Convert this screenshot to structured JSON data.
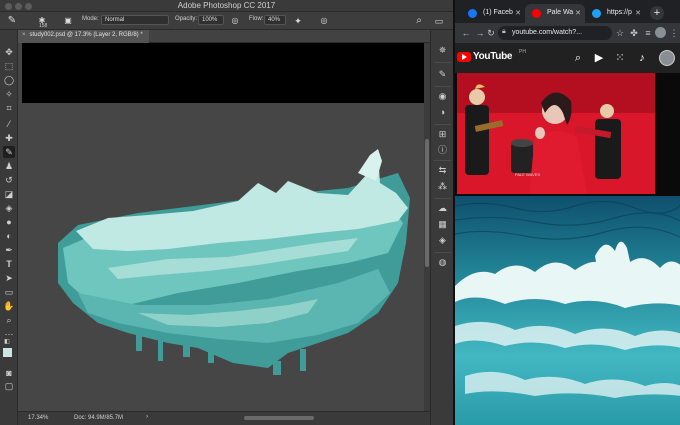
{
  "photoshop": {
    "window_title": "Adobe Photoshop CC 2017",
    "options": {
      "brush_size": "158",
      "mode_label": "Mode:",
      "mode_value": "Normal",
      "opacity_label": "Opacity:",
      "opacity_value": "100%",
      "flow_label": "Flow:",
      "flow_value": "40%"
    },
    "document_tab": "study002.psd @ 17.3% (Layer 2, RGB/8) *",
    "status": {
      "zoom": "17.34%",
      "doc_size": "Doc: 94.9M/85.7M"
    },
    "colors": {
      "foreground": "#c9e6e4",
      "background": "#ffffff",
      "wave_light": "#bfe9e2",
      "wave_mid": "#6fc6bf",
      "wave_dark": "#3f9c99"
    }
  },
  "chrome": {
    "tabs": [
      {
        "title": "(1) Faceb",
        "icon": "facebook-icon",
        "color": "#1877f2"
      },
      {
        "title": "Pale Wa",
        "icon": "youtube-icon",
        "color": "#ff0000"
      },
      {
        "title": "https://p",
        "icon": "twitter-icon",
        "color": "#1da1f2"
      }
    ],
    "url": "youtube.com/watch?...",
    "youtube": {
      "logo_text": "YouTube",
      "region": "PH"
    },
    "video_overlay_text": "PALE WAVES"
  }
}
